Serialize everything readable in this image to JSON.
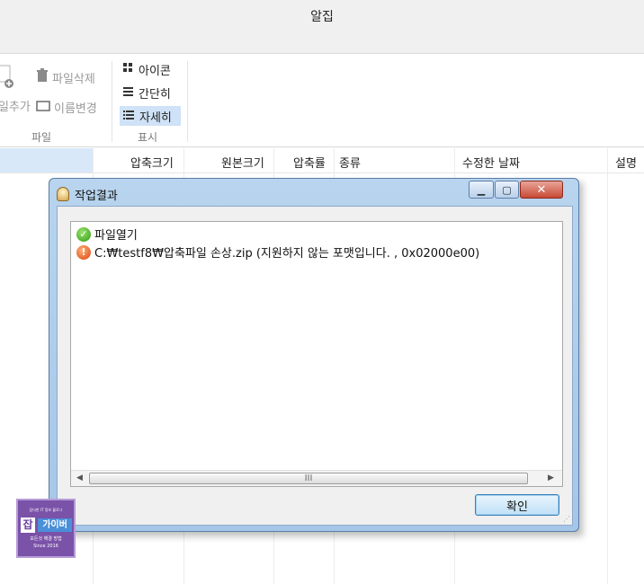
{
  "window": {
    "title": "알집"
  },
  "ribbon": {
    "file_group": {
      "add_file_label": "일추가",
      "delete_file_label": "파일삭제",
      "rename_label": "이름변경",
      "group_label": "파일"
    },
    "view_group": {
      "items": [
        {
          "label": "아이콘",
          "icon": "grid-icon",
          "active": false
        },
        {
          "label": "간단히",
          "icon": "list-icon",
          "active": false
        },
        {
          "label": "자세히",
          "icon": "details-icon",
          "active": true
        }
      ],
      "group_label": "표시"
    }
  },
  "file_list": {
    "columns": [
      "압축크기",
      "원본크기",
      "압축률",
      "종류",
      "수정한 날짜",
      "설명"
    ]
  },
  "dialog": {
    "title": "작업결과",
    "log": [
      {
        "status": "ok",
        "icon": "check-circle-icon",
        "text": "파일열기"
      },
      {
        "status": "error",
        "icon": "error-circle-icon",
        "text": "C:₩testf8₩압축파일 손상.zip (지원하지 않는 포맷입니다. , 0x02000e00)"
      }
    ],
    "scroll_grip": "III",
    "ok_label": "확인"
  },
  "watermark": {
    "top": "잡다한 IT 정보 블로그",
    "jam": "잡",
    "brand": "가이버",
    "sub": "모든것 해결 방법",
    "since": "Since 2016"
  },
  "colors": {
    "accent_selection": "#cfe2f7",
    "dialog_frame": "#a5c6e8",
    "close_button": "#c84a35",
    "ok_button_border": "#3c7fb1"
  }
}
